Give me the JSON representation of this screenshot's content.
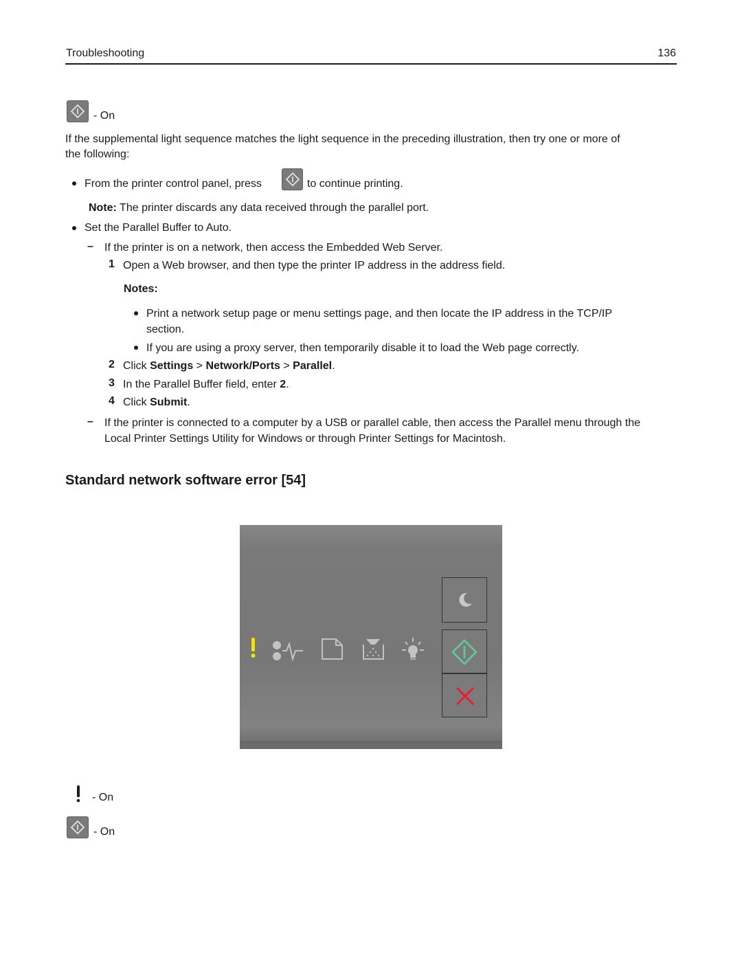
{
  "header": {
    "section": "Troubleshooting",
    "page_number": "136"
  },
  "top_indicator": {
    "icon": "start-button-icon",
    "status": "- On"
  },
  "intro": "If the supplemental light sequence matches the light sequence in the preceding illustration, then try one or more of",
  "intro_cont": "the following:",
  "bullets": [
    {
      "pre": "From the printer control panel, press",
      "icon": "start-button-icon",
      "post": "to continue printing."
    },
    {
      "text": "Set the Parallel Buffer to Auto."
    }
  ],
  "note": {
    "label": "Note:",
    "text": " The printer discards any data received through the parallel port."
  },
  "dash_items": [
    {
      "text": "If the printer is on a network, then access the Embedded Web Server."
    },
    {
      "line1": "If the printer is connected to a computer by a USB or parallel cable, then access the Parallel menu through the",
      "line2": "Local Printer Settings Utility for Windows or through Printer Settings for Macintosh."
    }
  ],
  "steps": {
    "s1": {
      "num": "1",
      "text": "Open a Web browser, and then type the printer IP address in the address field."
    },
    "notes_label": "Notes:",
    "notes": [
      {
        "line1": "Print a network setup page or menu settings page, and then locate the IP address in the TCP/IP",
        "line2": "section."
      },
      {
        "text": "If you are using a proxy server, then temporarily disable it to load the Web page correctly."
      }
    ],
    "s2": {
      "num": "2",
      "pre": "Click ",
      "b1": "Settings",
      "sep1": " > ",
      "b2": "Network/Ports",
      "sep2": " > ",
      "b3": "Parallel",
      "post": "."
    },
    "s3": {
      "num": "3",
      "pre": "In the Parallel Buffer field, enter ",
      "b": "2",
      "post": "."
    },
    "s4": {
      "num": "4",
      "pre": "Click ",
      "b": "Submit",
      "post": "."
    }
  },
  "section_title": "Standard network software error [54]",
  "panel": {
    "lights": [
      {
        "name": "error-light",
        "state": "on",
        "color": "#f5e400"
      },
      {
        "name": "ready-data-light",
        "state": "off"
      },
      {
        "name": "paper-light",
        "state": "off"
      },
      {
        "name": "toner-light",
        "state": "off"
      },
      {
        "name": "imaging-unit-light",
        "state": "off"
      }
    ],
    "buttons": [
      {
        "name": "sleep-button",
        "state": "off"
      },
      {
        "name": "start-button",
        "state": "on",
        "color": "#5fc79a"
      },
      {
        "name": "stop-cancel-button",
        "state": "on",
        "color": "#e8202a"
      }
    ]
  },
  "legend": [
    {
      "icon": "exclamation-icon",
      "status": "- On"
    },
    {
      "icon": "start-button-icon",
      "status": "- On"
    }
  ]
}
